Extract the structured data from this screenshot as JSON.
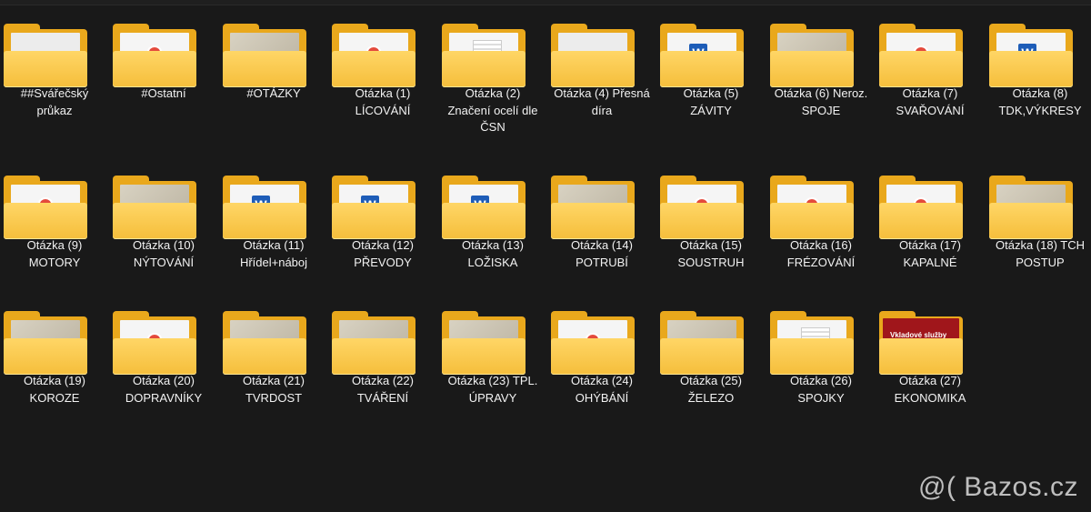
{
  "folders": [
    {
      "l1": "##Svářečský",
      "l2": "průkaz",
      "thumb": "blank"
    },
    {
      "l1": "#Ostatní",
      "l2": "",
      "thumb": "pdf"
    },
    {
      "l1": "#OTÁZKY",
      "l2": "",
      "thumb": "photo"
    },
    {
      "l1": "Otázka (1)",
      "l2": "LÍCOVÁNÍ",
      "thumb": "pdf"
    },
    {
      "l1": "Otázka (2)",
      "l2": "Značení ocelí dle",
      "l3": "ČSN",
      "thumb": "doc"
    },
    {
      "l1": "Otázka (4) Přesná",
      "l2": "díra",
      "thumb": "blank"
    },
    {
      "l1": "Otázka (5)",
      "l2": "ZÁVITY",
      "thumb": "word"
    },
    {
      "l1": "Otázka (6) Neroz.",
      "l2": "SPOJE",
      "thumb": "photo"
    },
    {
      "l1": "Otázka (7)",
      "l2": "SVAŘOVÁNÍ",
      "thumb": "pdf"
    },
    {
      "l1": "Otázka (8)",
      "l2": "TDK,VÝKRESY",
      "thumb": "word"
    },
    {
      "l1": "Otázka (9)",
      "l2": "MOTORY",
      "thumb": "pdf"
    },
    {
      "l1": "Otázka (10)",
      "l2": "NÝTOVÁNÍ",
      "thumb": "photo"
    },
    {
      "l1": "Otázka (11)",
      "l2": "Hřídel+náboj",
      "thumb": "word"
    },
    {
      "l1": "Otázka (12)",
      "l2": "PŘEVODY",
      "thumb": "word"
    },
    {
      "l1": "Otázka (13)",
      "l2": "LOŽISKA",
      "thumb": "word"
    },
    {
      "l1": "Otázka (14)",
      "l2": "POTRUBÍ",
      "thumb": "photo"
    },
    {
      "l1": "Otázka (15)",
      "l2": "SOUSTRUH",
      "thumb": "pdf"
    },
    {
      "l1": "Otázka (16)",
      "l2": "FRÉZOVÁNÍ",
      "thumb": "pdf"
    },
    {
      "l1": "Otázka (17)",
      "l2": "KAPALNÉ",
      "thumb": "pdf"
    },
    {
      "l1": "Otázka (18) TCH",
      "l2": "POSTUP",
      "thumb": "photo"
    },
    {
      "l1": "Otázka (19)",
      "l2": "KOROZE",
      "thumb": "photo"
    },
    {
      "l1": "Otázka (20)",
      "l2": "DOPRAVNÍKY",
      "thumb": "pdf"
    },
    {
      "l1": "Otázka (21)",
      "l2": "TVRDOST",
      "thumb": "photo"
    },
    {
      "l1": "Otázka (22)",
      "l2": "TVÁŘENÍ",
      "thumb": "photo"
    },
    {
      "l1": "Otázka (23) TPL.",
      "l2": "ÚPRAVY",
      "thumb": "photo"
    },
    {
      "l1": "Otázka (24)",
      "l2": "OHÝBÁNÍ",
      "thumb": "pdf"
    },
    {
      "l1": "Otázka (25)",
      "l2": "ŽELEZO",
      "thumb": "photo"
    },
    {
      "l1": "Otázka (26)",
      "l2": "SPOJKY",
      "thumb": "doc"
    },
    {
      "l1": "Otázka (27)",
      "l2": "EKONOMIKA",
      "thumb": "red"
    }
  ],
  "watermark": "@( Bazos.cz"
}
